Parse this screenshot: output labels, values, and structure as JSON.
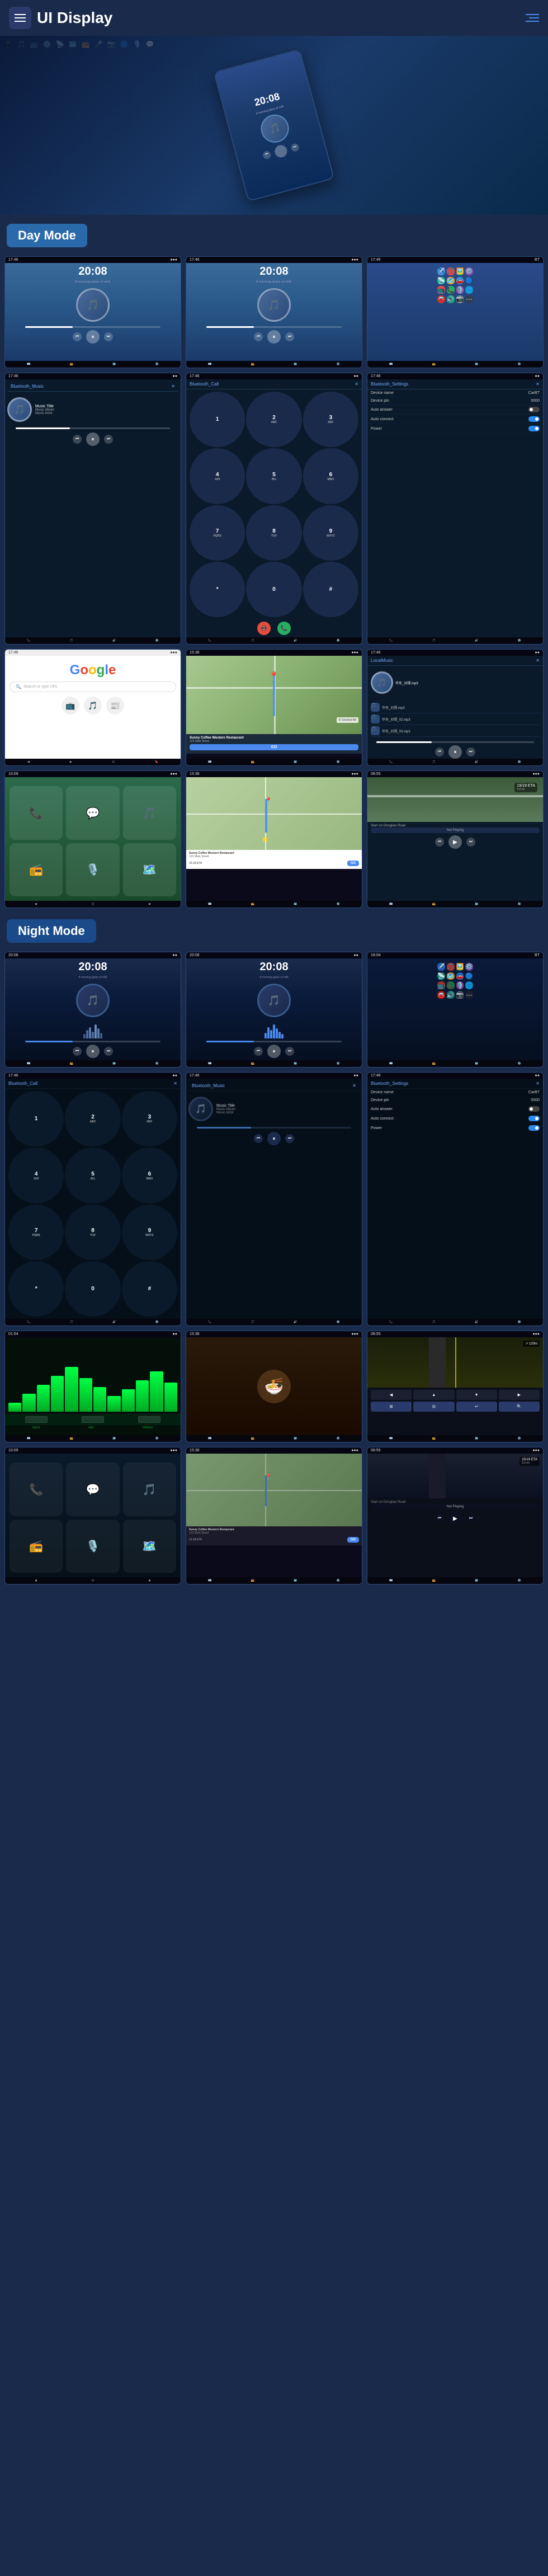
{
  "header": {
    "title": "UI Display",
    "menu_label": "menu",
    "nav_label": "navigation"
  },
  "sections": {
    "day_mode": "Day Mode",
    "night_mode": "Night Mode"
  },
  "music": {
    "title": "Music Title",
    "album": "Music Album",
    "artist": "Music Artist",
    "time": "20:08",
    "subtitle": "A morning glass of milk"
  },
  "phone": {
    "title": "Bluetooth_Call",
    "digits": [
      "1",
      "2",
      "3",
      "4",
      "5",
      "6",
      "7",
      "8",
      "9",
      "*",
      "0",
      "#"
    ]
  },
  "settings": {
    "title": "Bluetooth_Settings",
    "device_name_label": "Device name",
    "device_name_value": "CarBT",
    "device_pin_label": "Device pin",
    "device_pin_value": "0000",
    "auto_answer_label": "Auto answer",
    "auto_connect_label": "Auto connect",
    "power_label": "Power"
  },
  "bluetooth_music": {
    "title": "Bluetooth_Music"
  },
  "navigation": {
    "restaurant_name": "Sunny Coffee Western Restaurant",
    "address": "123 Main Street",
    "eta_label": "15:18 ETA",
    "distance": "5.0 mi",
    "go_btn": "GO",
    "not_playing": "Not Playing",
    "start_label": "Start on Dongliao Road"
  },
  "local_music": {
    "title": "LocalMusic",
    "files": [
      "华东_对视.mp3",
      "华东_对视_02.mp3",
      "华东_对视_03.mp3"
    ]
  },
  "apps": {
    "icons": [
      "📱",
      "📺",
      "🎵",
      "⚙️",
      "📡",
      "🗺️",
      "📻",
      "🎤",
      "📷",
      "🔵",
      "🎙️",
      "💬",
      "🚘",
      "🔊",
      "📞",
      "🌐"
    ]
  },
  "status_bar": {
    "time": "17:46",
    "signal": "●●●",
    "battery": "⬛"
  }
}
